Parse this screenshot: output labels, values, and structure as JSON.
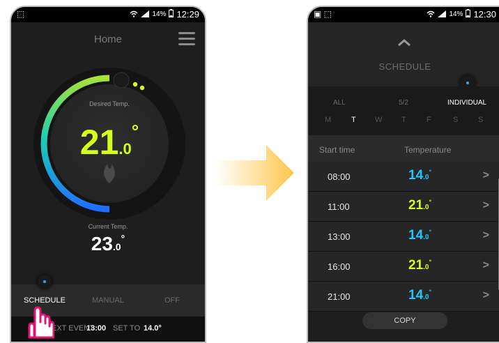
{
  "left_phone": {
    "status": {
      "battery": "14%",
      "time": "12:29"
    },
    "title": "Home",
    "desired_label": "Desired Temp.",
    "desired_int": "21",
    "desired_dec": ".0",
    "degree": "°",
    "current_label": "Current Temp.",
    "current_int": "23",
    "current_dec": ".0",
    "tabs": [
      "SCHEDULE",
      "MANUAL",
      "OFF"
    ],
    "next_event": {
      "label": "EXT EVENT",
      "time": "13:00",
      "set_label": "SET TO",
      "set_value": "14.0°"
    }
  },
  "right_phone": {
    "status": {
      "battery": "14%",
      "time": "12:30"
    },
    "title": "SCHEDULE",
    "modes": [
      "ALL",
      "5/2",
      "INDIVIDUAL"
    ],
    "active_mode": "INDIVIDUAL",
    "days": [
      "M",
      "T",
      "W",
      "T",
      "F",
      "S",
      "S"
    ],
    "active_day_index": 1,
    "columns": [
      "Start time",
      "Temperature"
    ],
    "rows": [
      {
        "time": "08:00",
        "temp": "14",
        "dec": ".0",
        "color": "#1ec8ff"
      },
      {
        "time": "11:00",
        "temp": "21",
        "dec": ".0",
        "color": "#d4ff1a"
      },
      {
        "time": "13:00",
        "temp": "14",
        "dec": ".0",
        "color": "#1ec8ff"
      },
      {
        "time": "16:00",
        "temp": "21",
        "dec": ".0",
        "color": "#d4ff1a"
      },
      {
        "time": "21:00",
        "temp": "14",
        "dec": ".0",
        "color": "#1ec8ff"
      }
    ],
    "copy_label": "COPY"
  },
  "colors": {
    "accent_yellow": "#d4ff1a",
    "accent_blue": "#1ec8ff",
    "arrow": "#ffc64a"
  }
}
